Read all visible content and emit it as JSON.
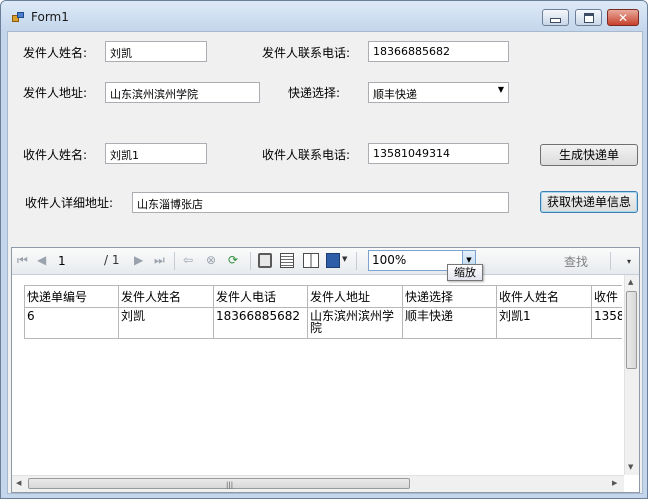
{
  "window": {
    "title": "Form1"
  },
  "form": {
    "sender_name_label": "发件人姓名:",
    "sender_name_value": "刘凯",
    "sender_phone_label": "发件人联系电话:",
    "sender_phone_value": "18366885682",
    "sender_address_label": "发件人地址:",
    "sender_address_value": "山东滨州滨州学院",
    "courier_label": "快递选择:",
    "courier_value": "顺丰快递",
    "receiver_name_label": "收件人姓名:",
    "receiver_name_value": "刘凯1",
    "receiver_phone_label": "收件人联系电话:",
    "receiver_phone_value": "13581049314",
    "receiver_address_label": "收件人详细地址:",
    "receiver_address_value": "山东淄博张店",
    "generate_button": "生成快递单",
    "fetch_button": "获取快递单信息"
  },
  "report": {
    "toolbar": {
      "page_current": "1",
      "page_total": "/ 1",
      "zoom": "100%",
      "find": "查找"
    },
    "headers": [
      "快递单编号",
      "发件人姓名",
      "发件人电话",
      "发件人地址",
      "快递选择",
      "收件人姓名",
      "收件"
    ],
    "rows": [
      [
        "6",
        "刘凯",
        "18366885682",
        "山东滨州滨州学院",
        "顺丰快递",
        "刘凯1",
        "1358"
      ]
    ],
    "tooltip": "缩放"
  }
}
